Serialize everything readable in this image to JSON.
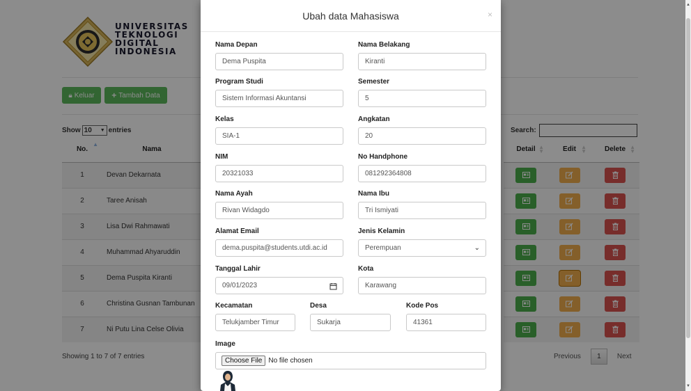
{
  "logo": {
    "lines": [
      "UNIVERSITAS",
      "TEKNOLOGI",
      "DIGITAL",
      "INDONESIA"
    ]
  },
  "toolbar": {
    "keluar_label": "Keluar",
    "tambah_label": "Tambah Data"
  },
  "table_controls": {
    "show_label": "Show",
    "entries_value": "10",
    "entries_label": "entries",
    "search_label": "Search:"
  },
  "table": {
    "headers": {
      "no": "No.",
      "nama": "Nama",
      "detail": "Detail",
      "edit": "Edit",
      "delete": "Delete"
    },
    "rows": [
      {
        "no": "1",
        "nama": "Devan Dekarnata"
      },
      {
        "no": "2",
        "nama": "Taree Anisah"
      },
      {
        "no": "3",
        "nama": "Lisa Dwi Rahmawati"
      },
      {
        "no": "4",
        "nama": "Muhammad Ahyaruddin"
      },
      {
        "no": "5",
        "nama": "Dema Puspita Kiranti"
      },
      {
        "no": "6",
        "nama": "Christina Gusnan Tambunan"
      },
      {
        "no": "7",
        "nama": "Ni Putu Lina Celse Olivia"
      }
    ],
    "info": "Showing 1 to 7 of 7 entries",
    "pager": {
      "previous": "Previous",
      "current": "1",
      "next": "Next"
    }
  },
  "modal": {
    "title": "Ubah data Mahasiswa",
    "close": "×",
    "fields": {
      "nama_depan": {
        "label": "Nama Depan",
        "value": "Dema Puspita"
      },
      "nama_belakang": {
        "label": "Nama Belakang",
        "value": "Kiranti"
      },
      "program_studi": {
        "label": "Program Studi",
        "value": "Sistem Informasi Akuntansi"
      },
      "semester": {
        "label": "Semester",
        "value": "5"
      },
      "kelas": {
        "label": "Kelas",
        "value": "SIA-1"
      },
      "angkatan": {
        "label": "Angkatan",
        "value": "20"
      },
      "nim": {
        "label": "NIM",
        "value": "20321033"
      },
      "no_handphone": {
        "label": "No Handphone",
        "value": "081292364808"
      },
      "nama_ayah": {
        "label": "Nama Ayah",
        "value": "Rivan Widagdo"
      },
      "nama_ibu": {
        "label": "Nama Ibu",
        "value": "Tri Ismiyati"
      },
      "alamat_email": {
        "label": "Alamat Email",
        "value": "dema.puspita@students.utdi.ac.id"
      },
      "jenis_kelamin": {
        "label": "Jenis Kelamin",
        "value": "Perempuan"
      },
      "tanggal_lahir": {
        "label": "Tanggal Lahir",
        "value": "09/01/2023"
      },
      "kota": {
        "label": "Kota",
        "value": "Karawang"
      },
      "kecamatan": {
        "label": "Kecamatan",
        "value": "Telukjamber Timur"
      },
      "desa": {
        "label": "Desa",
        "value": "Sukarja"
      },
      "kode_pos": {
        "label": "Kode Pos",
        "value": "41361"
      },
      "image": {
        "label": "Image",
        "button": "Choose File",
        "status": "No file chosen"
      }
    }
  },
  "colors": {
    "green": "#5cb85c",
    "orange": "#f0ad4e",
    "red": "#d9534f"
  },
  "icons": {
    "lock": "lock-icon",
    "plus": "plus-icon",
    "detail": "id-card-icon",
    "edit": "edit-icon",
    "delete": "trash-icon",
    "calendar": "calendar-icon",
    "dropdown": "chevron-down-icon"
  }
}
